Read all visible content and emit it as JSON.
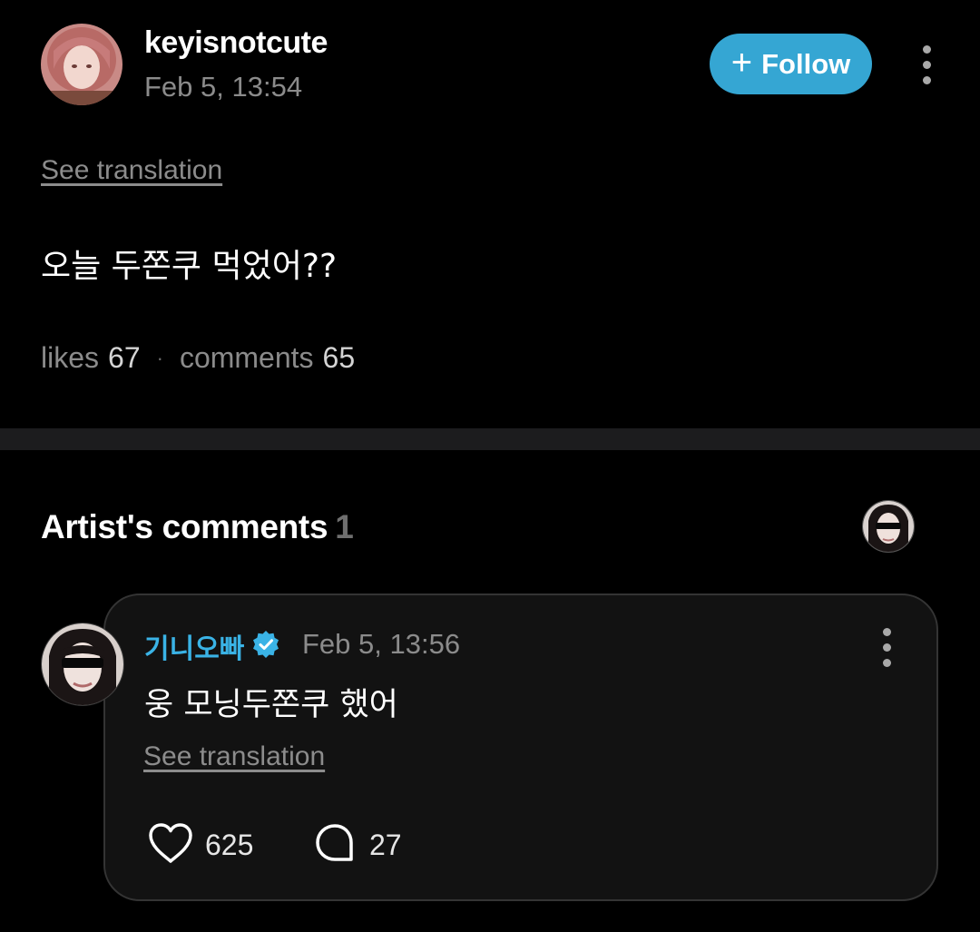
{
  "post": {
    "username": "keyisnotcute",
    "timestamp": "Feb 5, 13:54",
    "follow_label": "Follow",
    "follow_icon": "plus-icon",
    "more_icon": "more-vertical-icon",
    "see_translation": "See translation",
    "body": "오늘 두쫀쿠 먹었어??",
    "likes_label": "likes",
    "likes_count": "67",
    "comments_label": "comments",
    "comments_count": "65"
  },
  "artist_comments": {
    "title": "Artist's comments",
    "count": "1",
    "comment": {
      "author": "기니오빠",
      "verified_icon": "verified-badge-icon",
      "timestamp": "Feb 5, 13:56",
      "body": "웅 모닝두쫀쿠 했어",
      "see_translation": "See translation",
      "like_icon": "heart-icon",
      "like_count": "625",
      "reply_icon": "comment-bubble-icon",
      "reply_count": "27"
    }
  },
  "colors": {
    "background": "#000000",
    "accent": "#35a6d3",
    "artist_name": "#3ab3e6",
    "muted_text": "#8b8b8b",
    "card_border": "#343434"
  }
}
